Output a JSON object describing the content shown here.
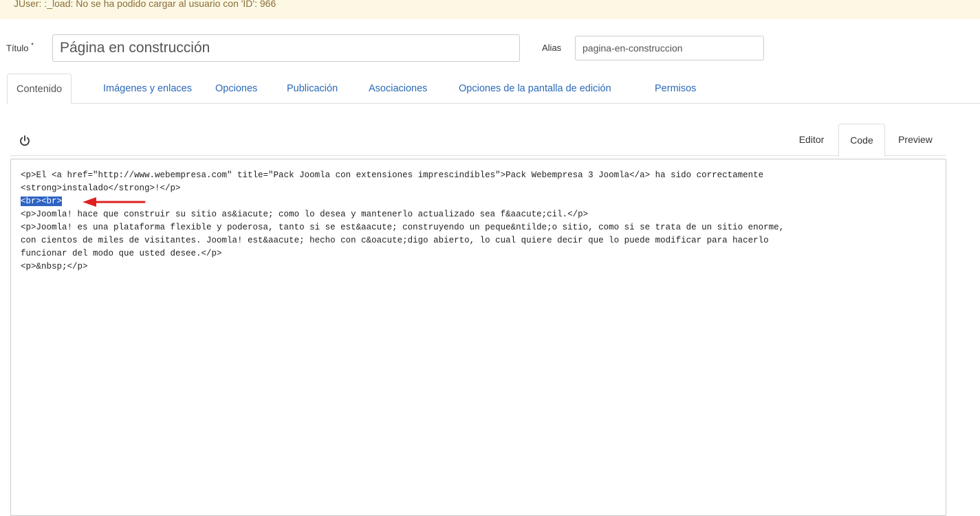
{
  "warning": {
    "message": "JUser: :_load: No se ha podido cargar al usuario con 'ID': 966"
  },
  "form": {
    "title_label": "Título",
    "required_mark": "*",
    "title_value": "Página en construcción",
    "alias_label": "Alias",
    "alias_value": "pagina-en-construccion"
  },
  "tabs": [
    {
      "label": "Contenido",
      "active": true
    },
    {
      "label": "Imágenes y enlaces",
      "active": false
    },
    {
      "label": "Opciones",
      "active": false
    },
    {
      "label": "Publicación",
      "active": false
    },
    {
      "label": "Asociaciones",
      "active": false
    },
    {
      "label": "Opciones de la pantalla de edición",
      "active": false
    },
    {
      "label": "Permisos",
      "active": false
    }
  ],
  "editor": {
    "toggle_icon": "power-icon",
    "modes": [
      {
        "label": "Editor",
        "active": false
      },
      {
        "label": "Code",
        "active": true
      },
      {
        "label": "Preview",
        "active": false
      }
    ],
    "code_lines": [
      "<p>El <a href=\"http://www.webempresa.com\" title=\"Pack Joomla con extensiones imprescindibles\">Pack Webempresa 3 Joomla</a> ha sido correctamente",
      "<strong>instalado</strong>!</p>",
      "<br><br>",
      "<p>Joomla! hace que construir su sitio as&iacute; como lo desea y mantenerlo actualizado sea f&aacute;cil.</p>",
      "<p>Joomla! es una plataforma flexible y poderosa, tanto si se est&aacute; construyendo un peque&ntilde;o sitio, como si se trata de un sitio enorme,",
      "con cientos de miles de visitantes. Joomla! est&aacute; hecho con c&oacute;digo abierto, lo cual quiere decir que lo puede modificar para hacerlo",
      "funcionar del modo que usted desee.</p>",
      "<p>&nbsp;</p>"
    ],
    "highlight_color": "#2e63c4",
    "arrow_color": "#e02020"
  }
}
